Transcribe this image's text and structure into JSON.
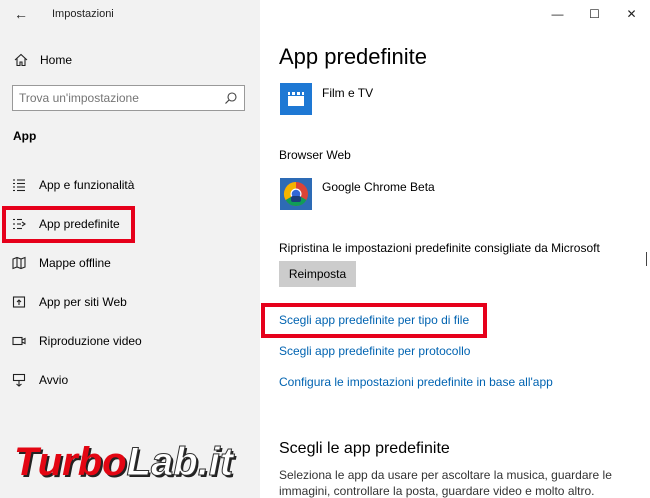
{
  "window": {
    "title": "Impostazioni",
    "back_glyph": "←",
    "controls": {
      "minimize": "—",
      "maximize": "☐",
      "close": "✕"
    }
  },
  "sidebar": {
    "home_label": "Home",
    "search_placeholder": "Trova un'impostazione",
    "section_label": "App",
    "items": [
      {
        "label": "App e funzionalità",
        "icon": "list-icon"
      },
      {
        "label": "App predefinite",
        "icon": "default-apps-icon",
        "selected": true
      },
      {
        "label": "Mappe offline",
        "icon": "map-icon"
      },
      {
        "label": "App per siti Web",
        "icon": "web-app-icon"
      },
      {
        "label": "Riproduzione video",
        "icon": "video-icon"
      },
      {
        "label": "Avvio",
        "icon": "startup-icon"
      }
    ]
  },
  "main": {
    "title": "App predefinite",
    "video_app": "Film e TV",
    "browser_label": "Browser Web",
    "browser_app": "Google Chrome Beta",
    "reset_label": "Ripristina le impostazioni predefinite consigliate da Microsoft",
    "reset_button": "Reimposta",
    "links": [
      "Scegli app predefinite per tipo di file",
      "Scegli app predefinite per protocollo",
      "Configura le impostazioni predefinite in base all'app"
    ],
    "section_heading": "Scegli le app predefinite",
    "section_desc": "Seleziona le app da usare per ascoltare la musica, guardare le immagini, controllare la posta, guardare video e molto altro."
  },
  "watermark": {
    "part1": "Turbo",
    "part2": "Lab.it"
  },
  "colors": {
    "accent": "#0063b1",
    "highlight": "#e6001b",
    "sidebar_bg": "#f2f2f2",
    "films_tile": "#1e78d4"
  }
}
